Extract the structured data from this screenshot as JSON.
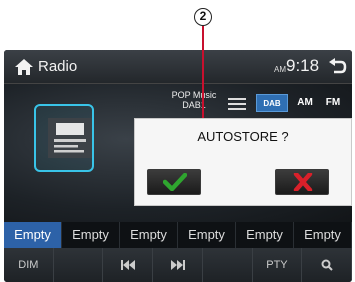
{
  "callout": {
    "number": "2"
  },
  "header": {
    "title": "Radio",
    "am_pm": "AM",
    "time": "9:18"
  },
  "station": {
    "name": "POP Music",
    "ensemble": "DAB1"
  },
  "bands": {
    "dab": "DAB",
    "am": "AM",
    "fm": "FM"
  },
  "presets": [
    "Empty",
    "Empty",
    "Empty",
    "Empty",
    "Empty",
    "Empty"
  ],
  "controls": {
    "dim": "DIM",
    "pty": "PTY"
  },
  "dialog": {
    "title": "AUTOSTORE ?"
  },
  "colors": {
    "accent": "#2d62a8",
    "dab_frame": "#39c4e8",
    "confirm": "#2fa52f",
    "cancel": "#d9202a"
  }
}
